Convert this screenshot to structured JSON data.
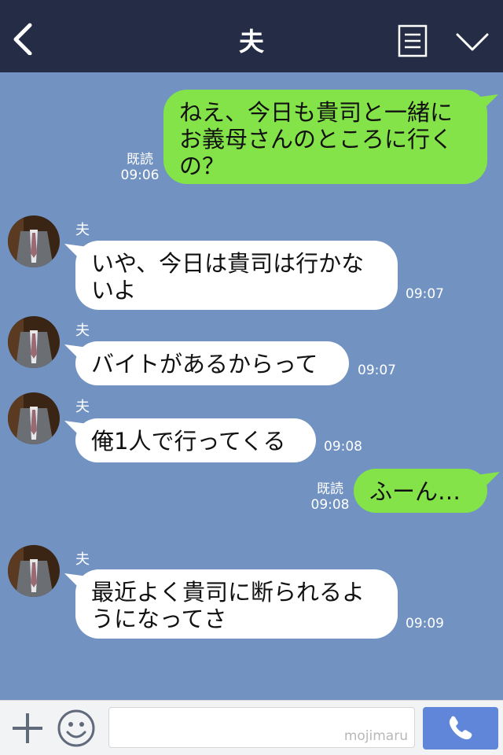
{
  "header": {
    "title": "夫"
  },
  "messages": [
    {
      "side": "out",
      "lines": [
        "ねえ、今日も貴司と一緒に",
        "お義母さんのところに行く",
        "の？"
      ],
      "read": "既読",
      "time": "09:06"
    },
    {
      "side": "in",
      "sender": "夫",
      "lines": [
        "いや、今日は貴司は行かな",
        "いよ"
      ],
      "time": "09:07"
    },
    {
      "side": "in",
      "sender": "夫",
      "lines": [
        "バイトがあるからって"
      ],
      "time": "09:07"
    },
    {
      "side": "in",
      "sender": "夫",
      "lines": [
        "俺1人で行ってくる"
      ],
      "time": "09:08"
    },
    {
      "side": "out",
      "lines": [
        "ふーん…"
      ],
      "read": "既読",
      "time": "09:08"
    },
    {
      "side": "in",
      "sender": "夫",
      "lines": [
        "最近よく貴司に断られるよ",
        "うになってさ"
      ],
      "time": "09:09"
    }
  ],
  "input": {
    "value": "",
    "watermark": "mojimaru"
  },
  "colors": {
    "header_bg": "#242d45",
    "chat_bg": "#7293c2",
    "bubble_out": "#84e349",
    "bubble_in": "#ffffff",
    "call_button": "#5f86d8"
  },
  "icons": {
    "back": "chevron-left-icon",
    "menu": "document-list-icon",
    "collapse": "chevron-down-icon",
    "plus": "plus-icon",
    "emoji": "smiley-icon",
    "call": "phone-icon"
  }
}
